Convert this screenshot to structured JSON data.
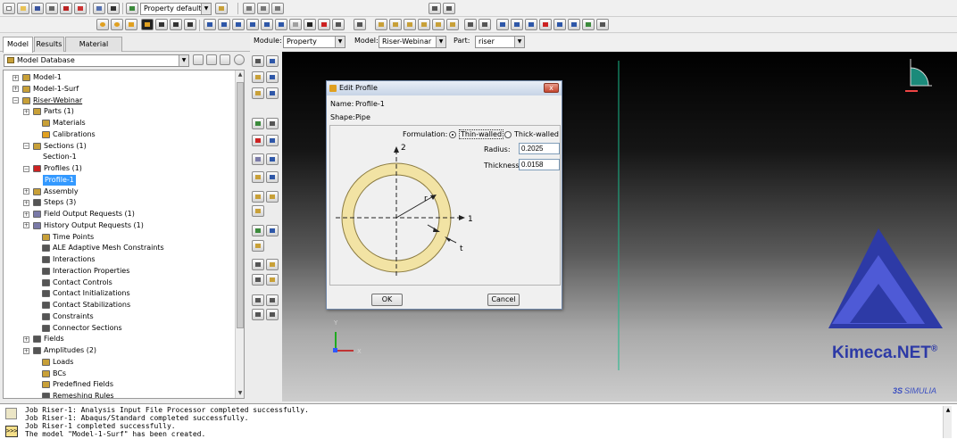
{
  "toolbar": {
    "render_style": "Property defaults"
  },
  "left_tabs": [
    "Model",
    "Results",
    "Material Library"
  ],
  "model_database": "Model Database",
  "tree": [
    {
      "label": "Model-1",
      "expander": "+"
    },
    {
      "label": "Model-1-Surf",
      "expander": "+"
    },
    {
      "label": "Riser-Webinar",
      "expander": "-"
    },
    {
      "label": "Parts (1)",
      "expander": "+"
    },
    {
      "label": "Materials",
      "expander": ""
    },
    {
      "label": "Calibrations",
      "expander": ""
    },
    {
      "label": "Sections (1)",
      "expander": "-"
    },
    {
      "label": "Section-1",
      "expander": ""
    },
    {
      "label": "Profiles (1)",
      "expander": "-"
    },
    {
      "label": "Profile-1",
      "expander": ""
    },
    {
      "label": "Assembly",
      "expander": "+"
    },
    {
      "label": "Steps (3)",
      "expander": "+"
    },
    {
      "label": "Field Output Requests (1)",
      "expander": "+"
    },
    {
      "label": "History Output Requests (1)",
      "expander": "+"
    },
    {
      "label": "Time Points",
      "expander": ""
    },
    {
      "label": "ALE Adaptive Mesh Constraints",
      "expander": ""
    },
    {
      "label": "Interactions",
      "expander": ""
    },
    {
      "label": "Interaction Properties",
      "expander": ""
    },
    {
      "label": "Contact Controls",
      "expander": ""
    },
    {
      "label": "Contact Initializations",
      "expander": ""
    },
    {
      "label": "Contact Stabilizations",
      "expander": ""
    },
    {
      "label": "Constraints",
      "expander": ""
    },
    {
      "label": "Connector Sections",
      "expander": ""
    },
    {
      "label": "Fields",
      "expander": "+"
    },
    {
      "label": "Amplitudes (2)",
      "expander": "+"
    },
    {
      "label": "Loads",
      "expander": ""
    },
    {
      "label": "BCs",
      "expander": ""
    },
    {
      "label": "Predefined Fields",
      "expander": ""
    },
    {
      "label": "Remeshing Rules",
      "expander": ""
    }
  ],
  "context": {
    "module_label": "Module:",
    "module_value": "Property",
    "model_label": "Model:",
    "model_value": "Riser-Webinar",
    "part_label": "Part:",
    "part_value": "riser"
  },
  "dialog": {
    "title": "Edit Profile",
    "name_label": "Name:",
    "name_value": "Profile-1",
    "shape_label": "Shape:",
    "shape_value": "Pipe",
    "formulation_label": "Formulation:",
    "thin_walled": "Thin-walled",
    "thick_walled": "Thick-walled",
    "radius_label": "Radius:",
    "radius_value": "0.2025",
    "thickness_label": "Thickness:",
    "thickness_value": "0.0158",
    "axis1": "1",
    "axis2": "2",
    "r_label": "r",
    "t_label": "t",
    "ok": "OK",
    "cancel": "Cancel",
    "close_glyph": "x"
  },
  "triad": {
    "y": "Y",
    "x": "X",
    "z": "Z"
  },
  "branding": {
    "logo": "Kimeca.NET",
    "registered": "®",
    "simulia": "SIMULIA",
    "ds": "3S"
  },
  "messages": [
    "Job Riser-1: Analysis Input File Processor completed successfully.",
    "Job Riser-1: Abaqus/Standard completed successfully.",
    "Job Riser-1 completed successfully.",
    "The model \"Model-1-Surf\" has been created."
  ],
  "colors": {
    "ring_fill": "#f2e3a4",
    "ring_stroke": "#8a7a40",
    "logo_blue": "#2d3aa6",
    "selection": "#3399ff"
  }
}
